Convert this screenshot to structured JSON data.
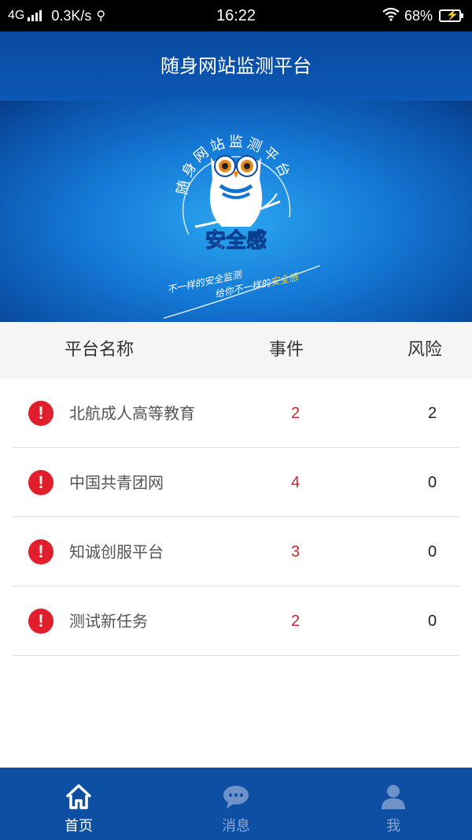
{
  "status_bar": {
    "network": "4G",
    "speed": "0.3K/s",
    "time": "16:22",
    "battery": "68%"
  },
  "header": {
    "title": "随身网站监测平台"
  },
  "banner": {
    "arc_text": "随身网站监测平台",
    "logo_text": "安全感",
    "slogan_line1": "不一样的安全监测",
    "slogan_line2_prefix": "给你不一样的",
    "slogan_line2_highlight": "安全感"
  },
  "list_header": {
    "name": "平台名称",
    "event": "事件",
    "risk": "风险"
  },
  "rows": [
    {
      "name": "北航成人高等教育",
      "event": "2",
      "risk": "2"
    },
    {
      "name": "中国共青团网",
      "event": "4",
      "risk": "0"
    },
    {
      "name": "知诚创服平台",
      "event": "3",
      "risk": "0"
    },
    {
      "name": "测试新任务",
      "event": "2",
      "risk": "0"
    }
  ],
  "tabs": [
    {
      "label": "首页",
      "icon": "home-icon",
      "active": true
    },
    {
      "label": "消息",
      "icon": "message-icon",
      "active": false
    },
    {
      "label": "我",
      "icon": "user-icon",
      "active": false
    }
  ],
  "colors": {
    "primary": "#0d4fa3",
    "alert": "#e01e2c",
    "event_text": "#d0282e",
    "slogan_highlight": "#ffd21f"
  }
}
